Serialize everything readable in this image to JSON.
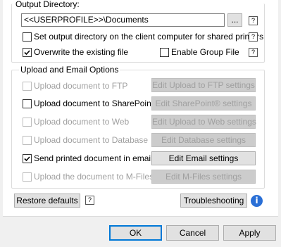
{
  "output": {
    "title": "Output Directory:",
    "path_value": "<<USERPROFILE>>\\Documents",
    "browse_label": "...",
    "help_label": "?",
    "set_client_dir_label": "Set output directory on the client computer for shared printers",
    "overwrite_label": "Overwrite the existing file",
    "group_file_label": "Enable Group File"
  },
  "upload": {
    "title": "Upload and Email Options",
    "rows": [
      {
        "label": "Upload document to FTP",
        "button": "Edit Upload to FTP settings",
        "checked": false,
        "enabled": false
      },
      {
        "label": "Upload document to SharePoint®",
        "button": "Edit SharePoint® settings",
        "checked": false,
        "enabled": true
      },
      {
        "label": "Upload document to Web",
        "button": "Edit Upload to Web settings",
        "checked": false,
        "enabled": false
      },
      {
        "label": "Upload document to Database",
        "button": "Edit Database settings",
        "checked": false,
        "enabled": false
      },
      {
        "label": "Send printed document in email",
        "button": "Edit Email settings",
        "checked": true,
        "enabled": true
      },
      {
        "label": "Upload the document to M-Files",
        "button": "Edit M-Files settings",
        "checked": false,
        "enabled": false
      }
    ]
  },
  "footer": {
    "restore_label": "Restore defaults",
    "help_label": "?",
    "troubleshooting_label": "Troubleshooting",
    "info_icon": "i"
  },
  "dialog": {
    "ok_label": "OK",
    "cancel_label": "Cancel",
    "apply_label": "Apply"
  },
  "state": {
    "set_client_dir_checked": false,
    "overwrite_checked": true,
    "group_file_checked": false
  }
}
